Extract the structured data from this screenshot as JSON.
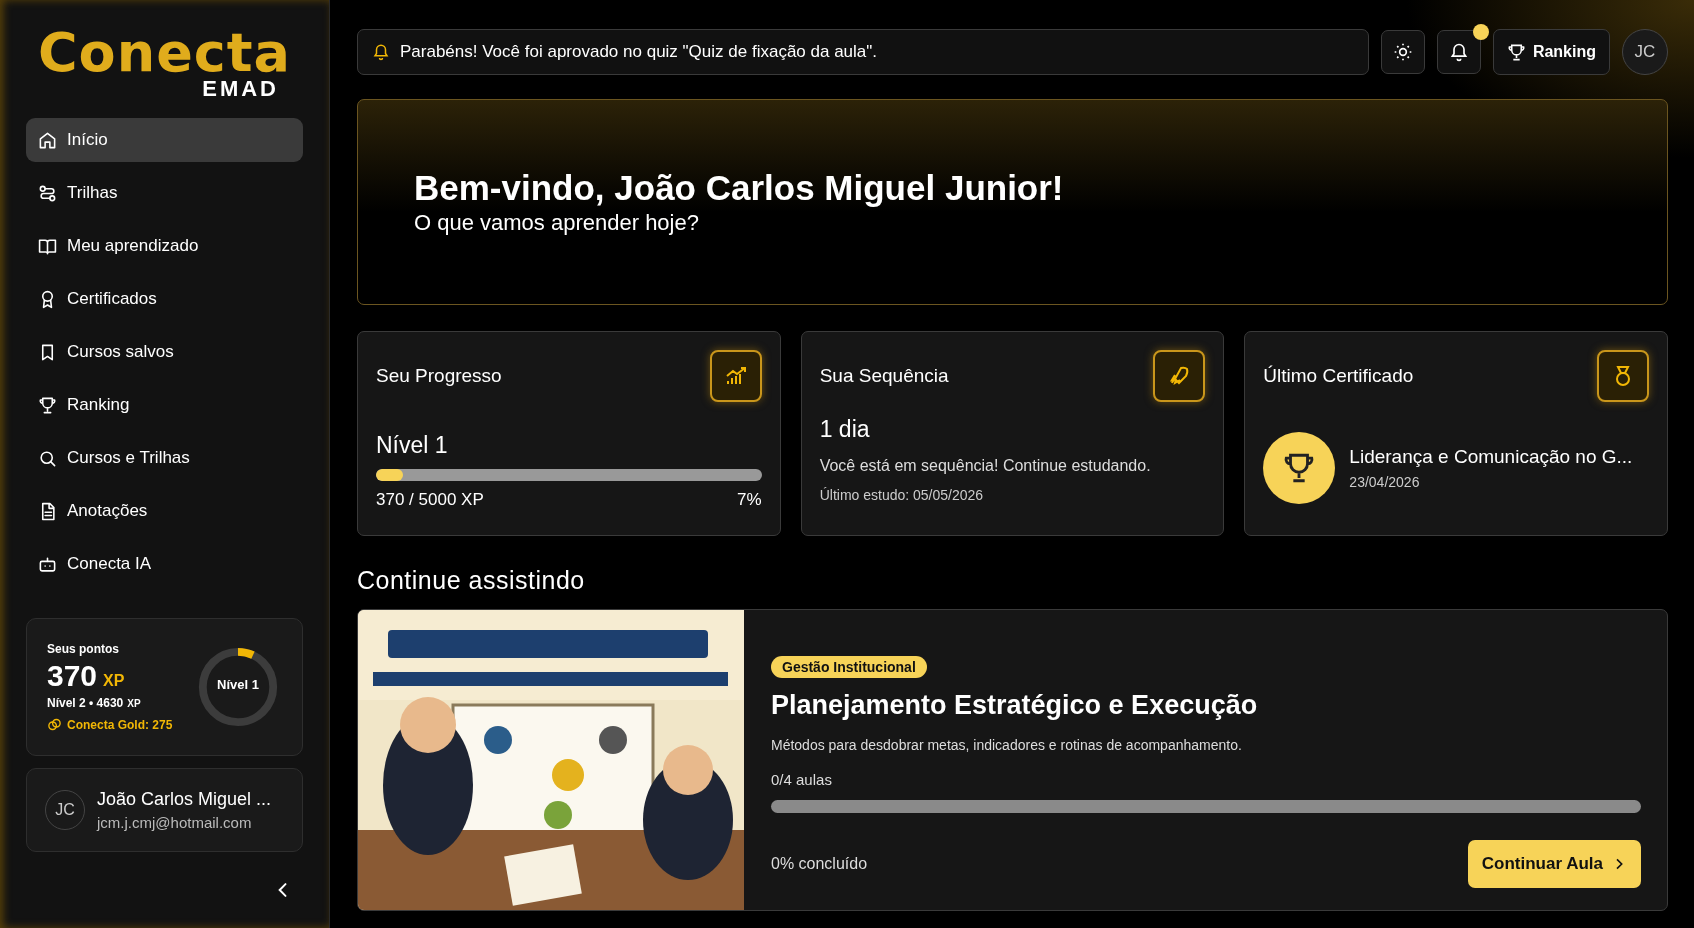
{
  "logo": {
    "name": "Conecta",
    "sub": "EMAD"
  },
  "nav": [
    {
      "label": "Início",
      "selected": true
    },
    {
      "label": "Trilhas",
      "selected": false
    },
    {
      "label": "Meu aprendizado",
      "selected": false
    },
    {
      "label": "Certificados",
      "selected": false
    },
    {
      "label": "Cursos salvos",
      "selected": false
    },
    {
      "label": "Ranking",
      "selected": false
    },
    {
      "label": "Cursos e Trilhas",
      "selected": false
    },
    {
      "label": "Anotações",
      "selected": false
    },
    {
      "label": "Conecta IA",
      "selected": false
    }
  ],
  "points": {
    "title": "Seus pontos",
    "value": "370",
    "unit": "XP",
    "next": "Nível 2 • 4630",
    "next_unit": "XP",
    "gold": "Conecta Gold: 275",
    "ring_label": "Nível 1",
    "level": 0.07
  },
  "user": {
    "initials": "JC",
    "name": "João Carlos Miguel ...",
    "email": "jcm.j.cmj@hotmail.com"
  },
  "notification": "Parabéns! Você foi aprovado no quiz \"Quiz de fixação da aula\".",
  "topbar": {
    "unread": true,
    "ranking": "Ranking",
    "avatar": "JC"
  },
  "hero": {
    "title": "Bem-vindo, João Carlos Miguel Junior!",
    "subtitle": "O que vamos aprender hoje?"
  },
  "progress_card": {
    "title": "Seu Progresso",
    "level_label": "Nível 1",
    "level": 0.07,
    "xp": "370 / 5000 XP",
    "percent": "7%"
  },
  "streak_card": {
    "title": "Sua Sequência",
    "days": "1 dia",
    "message": "Você está em sequência! Continue estudando.",
    "last": "Último estudo: 05/05/2026"
  },
  "certificate_card": {
    "title": "Último Certificado",
    "course": "Liderança e Comunicação no G...",
    "date": "23/04/2026"
  },
  "section_title": "Continue assistindo",
  "course": {
    "category": "Gestão Institucional",
    "title": "Planejamento Estratégico e Execução",
    "description": "Métodos para desdobrar metas, indicadores e rotinas de acompanhamento.",
    "lessons": "0/4 aulas",
    "level": 0,
    "completed": "0% concluído",
    "button": "Continuar Aula"
  }
}
